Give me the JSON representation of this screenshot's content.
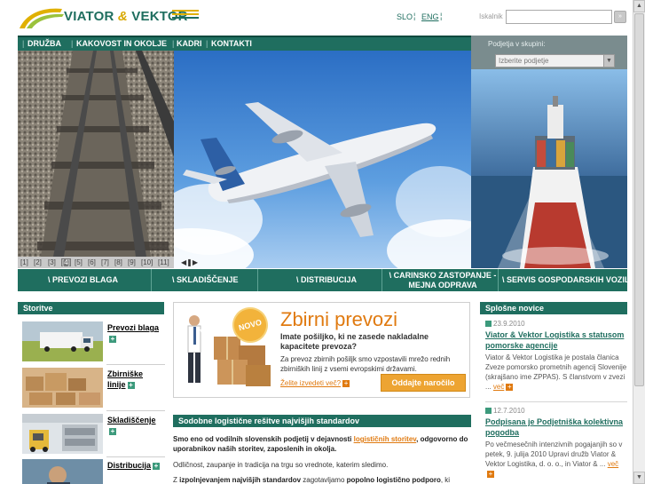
{
  "header": {
    "logo": {
      "part1": "VIATOR",
      "amp": "&",
      "part2": "VEKTOR"
    },
    "lang_slo": "SLO",
    "lang_eng": "ENG",
    "lang_sep": "¦",
    "search_label": "Iskalnik",
    "search_value": "",
    "search_button": "»"
  },
  "topnav": {
    "items": [
      "DRUŽBA",
      "KAKOVOST IN OKOLJE",
      "KADRI",
      "KONTAKTI"
    ],
    "separator": "|"
  },
  "podjetja": {
    "label": "Podjetja v skupini:",
    "select_value": "Izberite podjetje",
    "dropdown_icon": "▼"
  },
  "slider": {
    "pages": [
      "[1]",
      "[2]",
      "[3]",
      "[4]",
      "[5]",
      "[6]",
      "[7]",
      "[8]",
      "[9]",
      "[10]",
      "[11]"
    ],
    "active_index": 3,
    "controls": "◀❚▶"
  },
  "services_bar": {
    "items": [
      "\\ PREVOZI BLAGA",
      "\\ SKLADIŠČENJE",
      "\\ DISTRIBUCIJA",
      "\\ CARINSKO ZASTOPANJE - MEJNA ODPRAVA",
      "\\ SERVIS GOSPODARSKIH VOZIL"
    ],
    "item4_line1": "\\ CARINSKO ZASTOPANJE -",
    "item4_line2": "MEJNA ODPRAVA"
  },
  "storitve": {
    "heading": "Storitve",
    "items": [
      {
        "label_line1": "Prevozi blaga",
        "label_line2": ""
      },
      {
        "label_line1": "Zbirniške",
        "label_line2": "linije"
      },
      {
        "label_line1": "Skladiščenje",
        "label_line2": ""
      },
      {
        "label_line1": "Distribucija",
        "label_line2": ""
      }
    ],
    "plus_icon": "+"
  },
  "promo": {
    "badge": "NOVO",
    "title": "Zbirni prevozi",
    "subtitle": "Imate pošiljko, ki ne zasede nakladalne kapacitete prevoza?",
    "text": "Za prevoz zbirnih pošiljk smo vzpostavili mrežo rednih zbirniških linij z vsemi evropskimi državami.",
    "link": "Želite izvedeti več?",
    "button": "Oddajte naročilo"
  },
  "standards": {
    "heading": "Sodobne logistične rešitve najvišjih standardov",
    "p1_bold_a": "Smo eno od vodilnih slovenskih podjetij v dejavnosti ",
    "p1_link": "logističnih storitev",
    "p1_bold_b": ", odgovorno do uporabnikov naših storitev, zaposlenih in okolja.",
    "p2": "Odličnost, zaupanje in tradicija na trgu so vrednote, katerim sledimo.",
    "p3_a": "Z ",
    "p3_bold_a": "izpolnjevanjem najvišjih standardov",
    "p3_b": " zagotavljamo ",
    "p3_bold_b": "popolno logistično podporo",
    "p3_c": ", ki"
  },
  "news": {
    "heading": "Splošne novice",
    "more": "več",
    "items": [
      {
        "date": "23.9.2010",
        "title": "Viator & Vektor Logistika s statusom pomorske agencije",
        "body": "Viator & Vektor Logistika je postala članica Zveze pomorsko prometnih agencij Slovenije (skrajšano ime ZPPAS). S članstvom v zvezi ..."
      },
      {
        "date": "12.7.2010",
        "title": "Podpisana je Podjetniška kolektivna pogodba",
        "body": "Po večmesečnih intenzivnih pogajanjih so v petek, 9. julija 2010 Upravi družb Viator & Vektor Logistika, d. o. o., in Viator & ..."
      }
    ]
  },
  "colors": {
    "brand_green": "#1f6e5f",
    "accent_orange": "#e07a10",
    "logo_yellow": "#d8a800"
  }
}
